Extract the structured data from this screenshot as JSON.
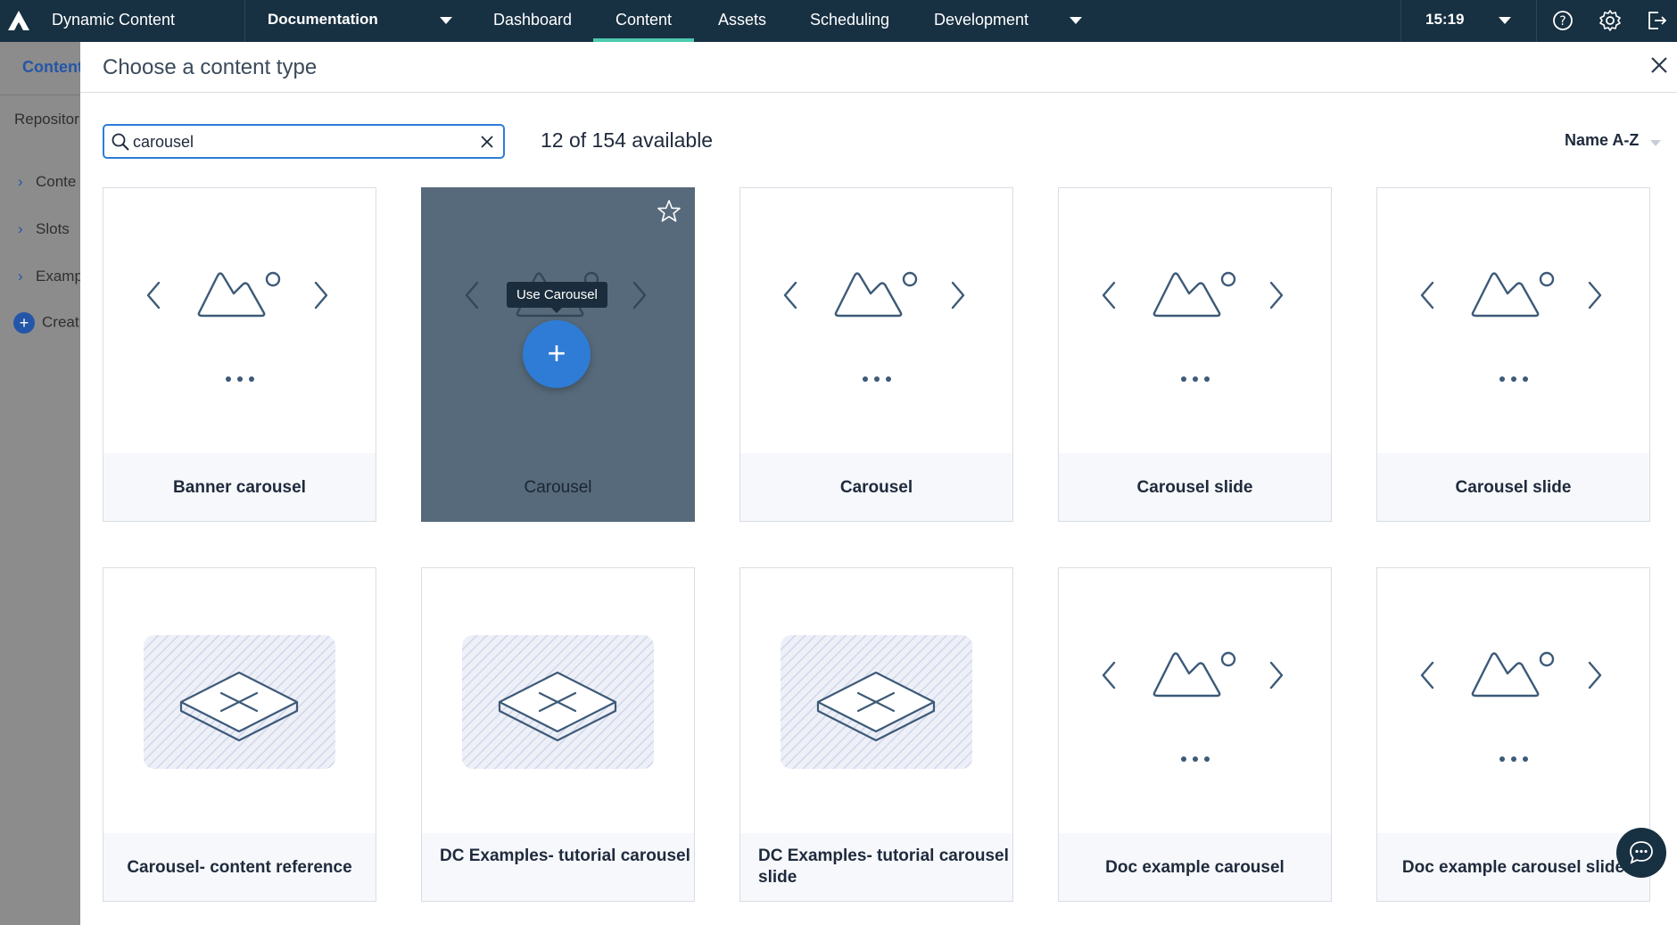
{
  "topbar": {
    "app_title": "Dynamic Content",
    "hub": "Documentation",
    "nav": [
      {
        "label": "Dashboard"
      },
      {
        "label": "Content"
      },
      {
        "label": "Assets"
      },
      {
        "label": "Scheduling"
      },
      {
        "label": "Development"
      }
    ],
    "active_nav": "Content",
    "time": "15:19",
    "icons": [
      "help-icon",
      "settings-icon",
      "logout-icon"
    ]
  },
  "background": {
    "title": "Content",
    "repo": "Repositor",
    "items": [
      "Conte",
      "Slots",
      "Examp"
    ],
    "create": "Creat"
  },
  "modal": {
    "title": "Choose a content type",
    "search": {
      "value": "carousel",
      "placeholder": ""
    },
    "count": "12 of 154 available",
    "sort": "Name A-Z",
    "hover_card": {
      "tooltip": "Use Carousel",
      "action_icon": "plus-icon"
    },
    "cards": [
      {
        "label": "Banner carousel",
        "icon": "carousel-icon"
      },
      {
        "label": "Carousel",
        "icon": "carousel-icon"
      },
      {
        "label": "Carousel",
        "icon": "carousel-icon"
      },
      {
        "label": "Carousel slide",
        "icon": "carousel-icon"
      },
      {
        "label": "Carousel slide",
        "icon": "carousel-icon"
      },
      {
        "label": "Carousel- content reference",
        "icon": "placeholder-icon"
      },
      {
        "label": "DC Examples- tutorial carousel",
        "icon": "placeholder-icon"
      },
      {
        "label": "DC Examples- tutorial carousel slide",
        "icon": "placeholder-icon"
      },
      {
        "label": "Doc example carousel",
        "icon": "carousel-icon"
      },
      {
        "label": "Doc example carousel slide",
        "icon": "carousel-icon"
      }
    ]
  },
  "colors": {
    "topbar": "#173042",
    "active_tab": "#4ec9b0",
    "accent": "#2f7cd6",
    "hover_card": "#576a7b",
    "icon_stroke": "#3d5a78"
  }
}
